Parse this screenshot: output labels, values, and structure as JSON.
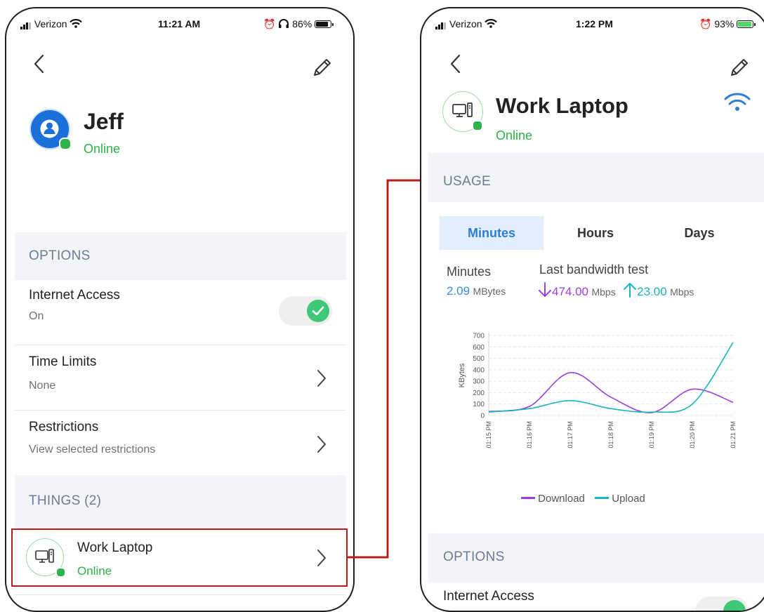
{
  "left": {
    "status": {
      "carrier": "Verizon",
      "time": "11:21 AM",
      "battery": "86%"
    },
    "profile": {
      "name": "Jeff",
      "status": "Online"
    },
    "options_header": "OPTIONS",
    "internet_access": {
      "title": "Internet Access",
      "value": "On",
      "enabled": true
    },
    "time_limits": {
      "title": "Time Limits",
      "value": "None"
    },
    "restrictions": {
      "title": "Restrictions",
      "value": "View selected restrictions"
    },
    "things_header": "THINGS (2)",
    "thing": {
      "name": "Work Laptop",
      "status": "Online"
    }
  },
  "right": {
    "status": {
      "carrier": "Verizon",
      "time": "1:22 PM",
      "battery": "93%"
    },
    "device": {
      "name": "Work Laptop",
      "status": "Online"
    },
    "usage_header": "USAGE",
    "tabs": [
      {
        "label": "Minutes",
        "active": true
      },
      {
        "label": "Hours",
        "active": false
      },
      {
        "label": "Days",
        "active": false
      }
    ],
    "stats": {
      "usage_label": "Minutes",
      "usage_value": "2.09",
      "usage_unit": "MBytes",
      "bandwidth_label": "Last bandwidth test",
      "download_value": "474.00",
      "upload_value": "23.00",
      "speed_unit": "Mbps"
    },
    "options_header": "OPTIONS",
    "internet_access_title": "Internet Access"
  },
  "colors": {
    "accent": "#2f7bd8",
    "online": "#2db34a",
    "download": "#9b3fe0",
    "upload": "#1bb3be",
    "highlight": "#b81d1d",
    "section_bg": "#f2f4f7"
  },
  "chart_data": {
    "type": "line",
    "ylabel": "KBytes",
    "ylim": [
      0,
      700
    ],
    "yticks": [
      0,
      100,
      200,
      300,
      400,
      500,
      600,
      700
    ],
    "categories": [
      "01:15 PM",
      "01:16 PM",
      "01:17 PM",
      "01:18 PM",
      "01:19 PM",
      "01:20 PM",
      "01:21 PM"
    ],
    "series": [
      {
        "name": "Download",
        "values": [
          35,
          80,
          375,
          160,
          25,
          230,
          115
        ]
      },
      {
        "name": "Upload",
        "values": [
          30,
          60,
          130,
          60,
          30,
          100,
          640
        ]
      }
    ],
    "grid": true,
    "legend": "bottom"
  }
}
